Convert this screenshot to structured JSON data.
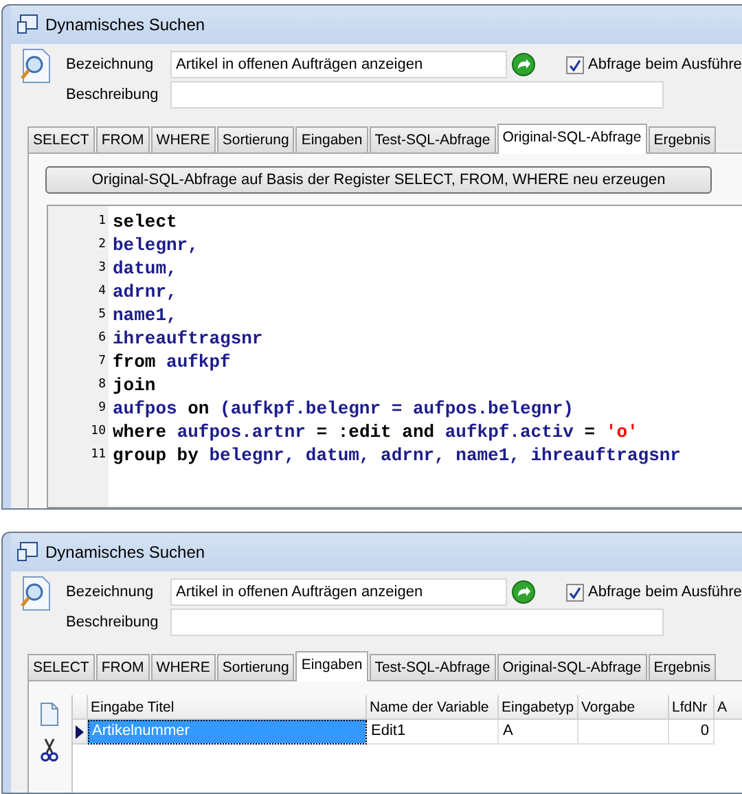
{
  "windows": [
    {
      "title": "Dynamisches Suchen",
      "fields": [
        {
          "label": "Bezeichnung",
          "value": "Artikel in offenen Aufträgen anzeigen"
        },
        {
          "label": "Beschreibung"
        }
      ],
      "checkbox": {
        "label": "Abfrage beim Ausführe",
        "checked": true
      },
      "tabs": [
        {
          "label": "SELECT",
          "selected": false
        },
        {
          "label": "FROM",
          "selected": false
        },
        {
          "label": "WHERE",
          "selected": false
        },
        {
          "label": "Sortierung",
          "selected": false
        },
        {
          "label": "Eingaben",
          "selected": false
        },
        {
          "label": "Test-SQL-Abfrage",
          "selected": false
        },
        {
          "label": "Original-SQL-Abfrage",
          "selected": true
        },
        {
          "label": "Ergebnis",
          "selected": false
        }
      ],
      "content": {
        "kind": "sql",
        "button": "Original-SQL-Abfrage auf Basis der Register SELECT, FROM, WHERE neu erzeugen",
        "lines": [
          {
            "number": "1",
            "tokens": [
              {
                "kind": "keyword",
                "text": "select"
              }
            ]
          },
          {
            "number": "2",
            "tokens": [
              {
                "kind": "ident",
                "text": "belegnr,"
              }
            ]
          },
          {
            "number": "3",
            "tokens": [
              {
                "kind": "ident",
                "text": "datum,"
              }
            ]
          },
          {
            "number": "4",
            "tokens": [
              {
                "kind": "ident",
                "text": "adrnr,"
              }
            ]
          },
          {
            "number": "5",
            "tokens": [
              {
                "kind": "ident",
                "text": "name1,"
              }
            ]
          },
          {
            "number": "6",
            "tokens": [
              {
                "kind": "ident",
                "text": "ihreauftragsnr"
              }
            ]
          },
          {
            "number": "7",
            "tokens": [
              {
                "kind": "keyword",
                "text": "from "
              },
              {
                "kind": "ident",
                "text": "aufkpf"
              }
            ]
          },
          {
            "number": "8",
            "tokens": [
              {
                "kind": "keyword",
                "text": "join"
              }
            ]
          },
          {
            "number": "9",
            "tokens": [
              {
                "kind": "ident",
                "text": "aufpos "
              },
              {
                "kind": "keyword",
                "text": "on "
              },
              {
                "kind": "ident",
                "text": "(aufkpf.belegnr = aufpos.belegnr)"
              }
            ]
          },
          {
            "number": "10",
            "tokens": [
              {
                "kind": "keyword",
                "text": "where "
              },
              {
                "kind": "ident",
                "text": "aufpos.artnr "
              },
              {
                "kind": "keyword",
                "text": "= :edit and "
              },
              {
                "kind": "ident",
                "text": "aufkpf.activ "
              },
              {
                "kind": "keyword",
                "text": "= "
              },
              {
                "kind": "string",
                "text": "'o'"
              }
            ]
          },
          {
            "number": "11",
            "tokens": [
              {
                "kind": "keyword",
                "text": "group by "
              },
              {
                "kind": "ident",
                "text": "belegnr, datum, adrnr, name1, ihreauftragsnr"
              }
            ]
          }
        ]
      }
    },
    {
      "title": "Dynamisches Suchen",
      "fields": [
        {
          "label": "Bezeichnung",
          "value": "Artikel in offenen Aufträgen anzeigen"
        },
        {
          "label": "Beschreibung"
        }
      ],
      "checkbox": {
        "label": "Abfrage beim Ausführe",
        "checked": true
      },
      "tabs": [
        {
          "label": "SELECT",
          "selected": false
        },
        {
          "label": "FROM",
          "selected": false
        },
        {
          "label": "WHERE",
          "selected": false
        },
        {
          "label": "Sortierung",
          "selected": false
        },
        {
          "label": "Eingaben",
          "selected": true
        },
        {
          "label": "Test-SQL-Abfrage",
          "selected": false
        },
        {
          "label": "Original-SQL-Abfrage",
          "selected": false
        },
        {
          "label": "Ergebnis",
          "selected": false
        }
      ],
      "content": {
        "kind": "grid",
        "columns": [
          "Eingabe Titel",
          "Name der Variable",
          "Eingabetyp",
          "Vorgabe",
          "LfdNr",
          "A"
        ],
        "rows": [
          {
            "selected": true,
            "cells": [
              "Artikelnummer",
              "Edit1",
              "A",
              null,
              "0"
            ]
          }
        ]
      }
    }
  ]
}
